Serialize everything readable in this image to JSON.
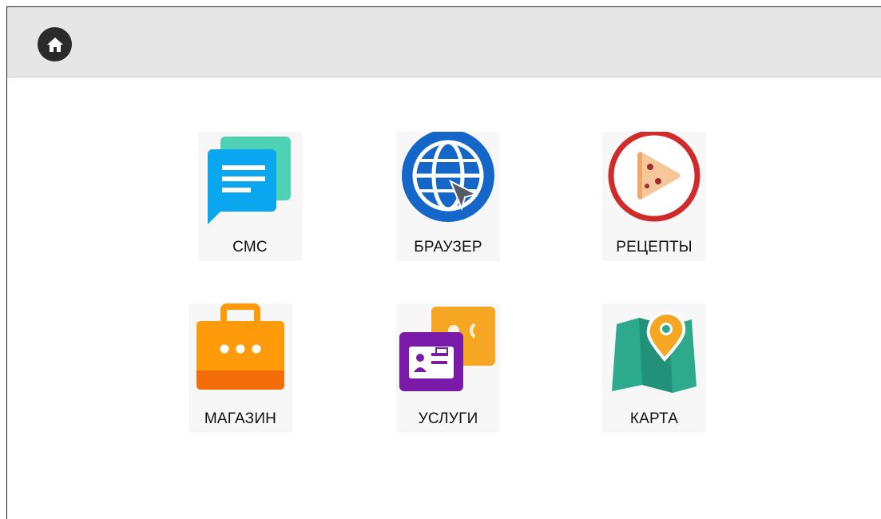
{
  "header": {
    "home_icon": "home-icon",
    "background": "#e6e6e6"
  },
  "apps": [
    {
      "label": "СМС",
      "icon": "sms-icon",
      "color": "#0aa7f0"
    },
    {
      "label": "БРАУЗЕР",
      "icon": "globe-cursor-icon",
      "color": "#1466c8"
    },
    {
      "label": "РЕЦЕПТЫ",
      "icon": "pizza-icon",
      "color": "#d02a2a"
    },
    {
      "label": "МАГАЗИН",
      "icon": "shopping-bag-icon",
      "color": "#ff9a0a"
    },
    {
      "label": "УСЛУГИ",
      "icon": "contact-cards-icon",
      "color": "#7a1aa8"
    },
    {
      "label": "КАРТА",
      "icon": "map-pin-icon",
      "color": "#2daa8c"
    }
  ]
}
